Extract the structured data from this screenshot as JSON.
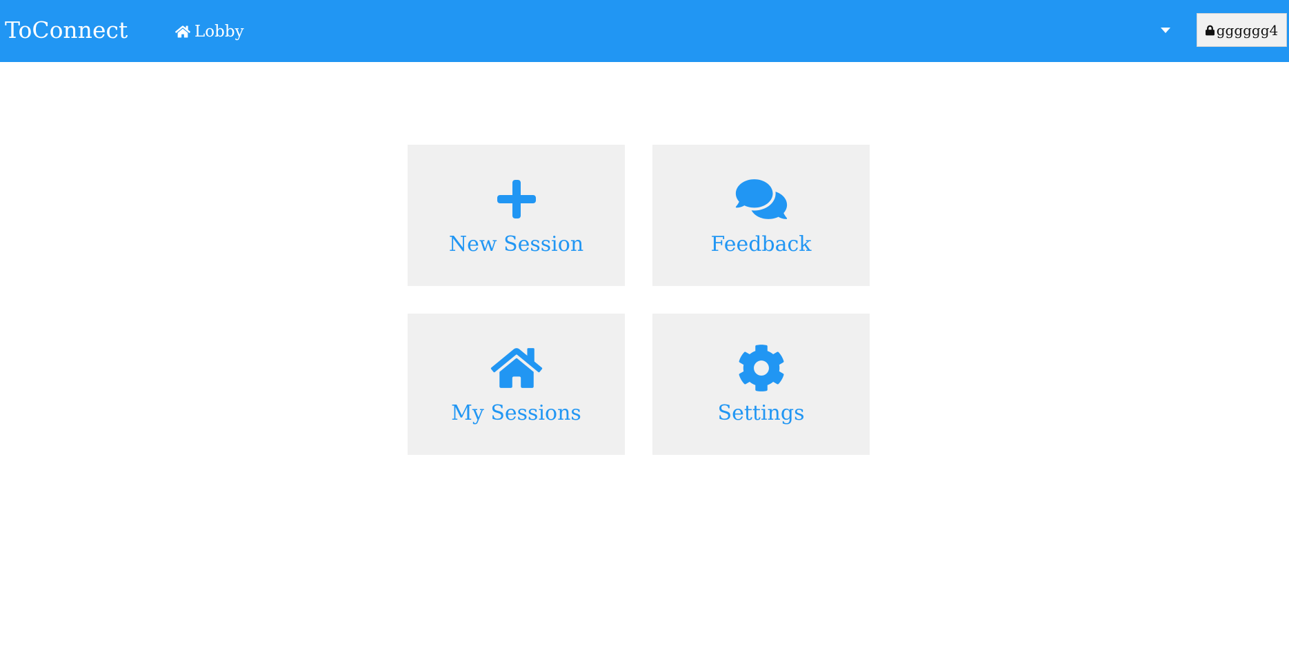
{
  "app": {
    "brand": "ToConnect"
  },
  "nav": {
    "lobby_label": "Lobby",
    "lobby_icon": "home-icon",
    "dropdown_icon": "caret-down-icon"
  },
  "user": {
    "name": "gggggg4",
    "icon": "lock-icon"
  },
  "tiles": [
    {
      "label": "New Session",
      "icon": "plus-icon"
    },
    {
      "label": "Feedback",
      "icon": "comments-icon"
    },
    {
      "label": "My Sessions",
      "icon": "home-icon"
    },
    {
      "label": "Settings",
      "icon": "gear-icon"
    }
  ],
  "colors": {
    "primary": "#2196f3",
    "tile_background": "#f0f0f0",
    "user_button_background": "#f1f1f1"
  }
}
